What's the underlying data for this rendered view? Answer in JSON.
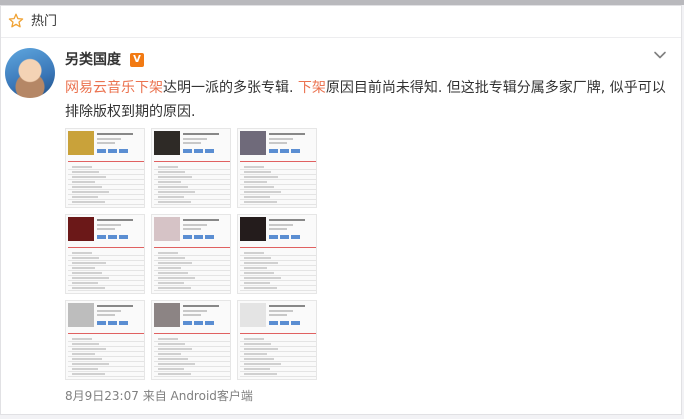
{
  "header": {
    "label": "热门",
    "icon": "star-outline-icon"
  },
  "post": {
    "username": "另类国度",
    "verified_badge": "V",
    "text_parts": [
      {
        "text": "网易云音乐下架",
        "highlight": true
      },
      {
        "text": "达明一派的多张专辑. ",
        "highlight": false
      },
      {
        "text": "下架",
        "highlight": true
      },
      {
        "text": "原因目前尚未得知. 但这批专辑分属多家厂牌, 似乎可以排除版权到期的原因.",
        "highlight": false
      }
    ],
    "images": [
      {
        "name": "album-screenshot-1",
        "cover_color": "#c9a23a"
      },
      {
        "name": "album-screenshot-2",
        "cover_color": "#2e2a26"
      },
      {
        "name": "album-screenshot-3",
        "cover_color": "#6f6a7a"
      },
      {
        "name": "album-screenshot-4",
        "cover_color": "#6b1818"
      },
      {
        "name": "album-screenshot-5",
        "cover_color": "#d6c3c6"
      },
      {
        "name": "album-screenshot-6",
        "cover_color": "#241c1c"
      },
      {
        "name": "album-screenshot-7",
        "cover_color": "#bdbdbd"
      },
      {
        "name": "album-screenshot-8",
        "cover_color": "#8c8484"
      },
      {
        "name": "album-screenshot-9",
        "cover_color": "#e4e4e4"
      }
    ],
    "timestamp": "8月9日23:07",
    "source": "来自 Android客户端"
  },
  "colors": {
    "highlight": "#eb7350",
    "accent": "#f27a13",
    "link_blue": "#5b8ed2"
  }
}
